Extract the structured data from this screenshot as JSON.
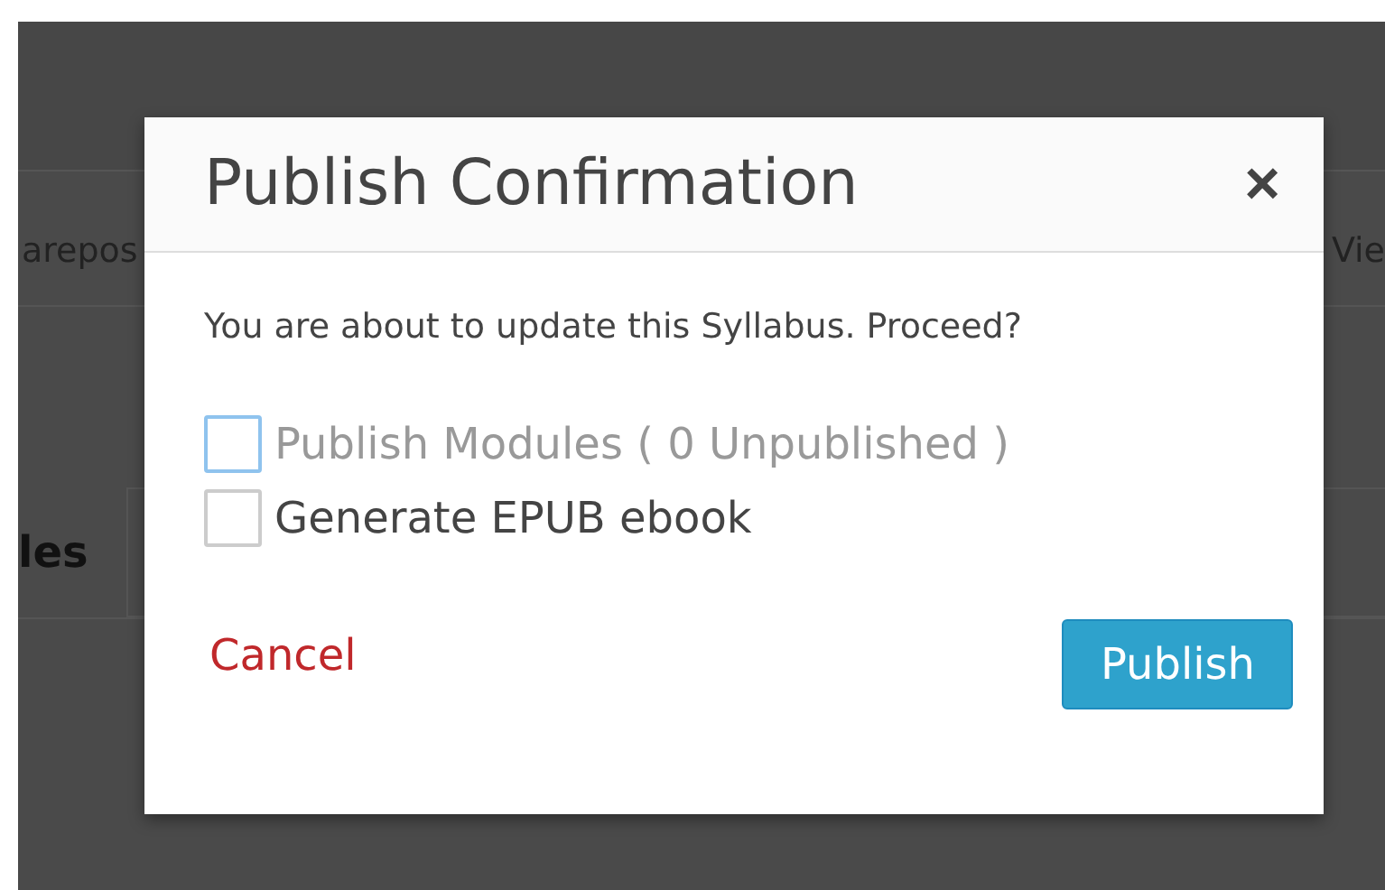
{
  "background": {
    "tab_left": "arepos",
    "tab_right": "Vie",
    "heading": "les"
  },
  "dialog": {
    "title": "Publish Confirmation",
    "close": "×",
    "message": "You are about to update this Syllabus. Proceed?",
    "options": [
      {
        "label": "Publish Modules ( 0 Unpublished )",
        "checked": false,
        "disabled": true
      },
      {
        "label": "Generate EPUB ebook",
        "checked": false,
        "disabled": false
      }
    ],
    "cancel": "Cancel",
    "confirm": "Publish"
  }
}
